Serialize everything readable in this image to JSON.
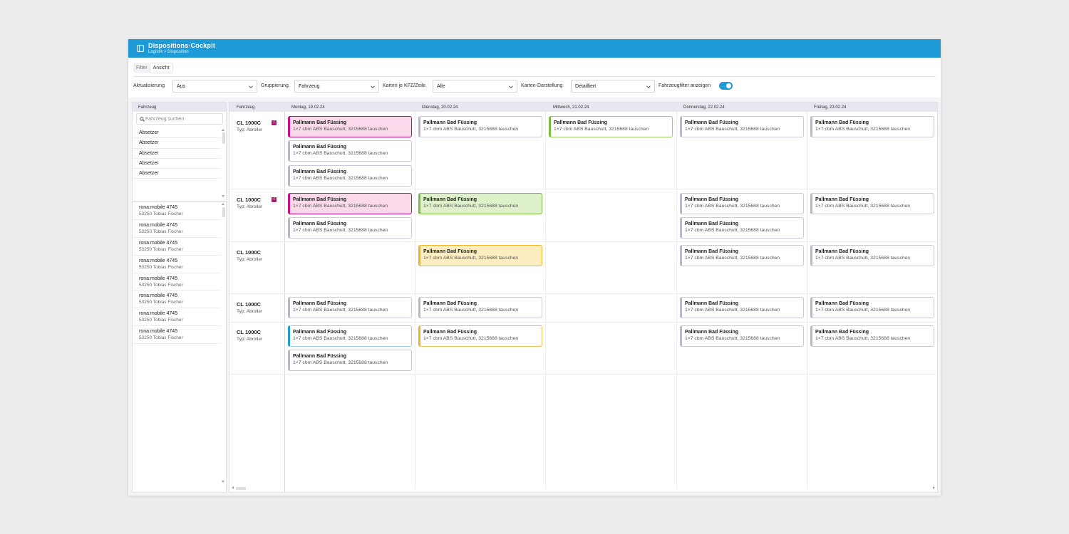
{
  "app": {
    "title": "Dispositions-Cockpit",
    "breadcrumb": "Logistik > Disposition",
    "accent_color": "#1e9ad6"
  },
  "tabs": [
    {
      "label": "Filter",
      "active": false
    },
    {
      "label": "Ansicht",
      "active": true
    }
  ],
  "filters": {
    "refresh": {
      "label": "Aktualisierung",
      "value": "Aus"
    },
    "grouping": {
      "label": "Gruppierung",
      "value": "Fahrzeug"
    },
    "cards_per_row": {
      "label": "Karten je KFZ/Zeile",
      "value": "Alle"
    },
    "card_display": {
      "label": "Karten-Darstellung",
      "value": "Detailliert"
    },
    "vehicle_filter_toggle": {
      "label": "Fahrzeugfilter anzeigen",
      "on": true
    }
  },
  "left_panel": {
    "header": "Fahrzeug",
    "search_placeholder": "Fahrzeug suchen",
    "types": [
      "Absetzer",
      "Absetzer",
      "Absetzer",
      "Absetzer",
      "Absetzer"
    ],
    "vehicles": [
      {
        "name": "rona:mobile 4745",
        "sub": "53250  Tobias Fischer"
      },
      {
        "name": "rona:mobile 4745",
        "sub": "53250  Tobias Fischer"
      },
      {
        "name": "rona:mobile 4745",
        "sub": "53250  Tobias Fischer"
      },
      {
        "name": "rona:mobile 4745",
        "sub": "53250  Tobias Fischer"
      },
      {
        "name": "rona:mobile 4745",
        "sub": "53250  Tobias Fischer"
      },
      {
        "name": "rona:mobile 4745",
        "sub": "53250  Tobias Fischer"
      },
      {
        "name": "rona:mobile 4745",
        "sub": "53250  Tobias Fischer"
      },
      {
        "name": "rona:mobile 4745",
        "sub": "53250  Tobias Fischer"
      }
    ]
  },
  "schedule": {
    "vehicle_header": "Fahrzeug",
    "days": [
      "Montag, 19.02.24",
      "Dienstag, 20.02.24",
      "Mittwoch, 21.02.24",
      "Donnerstag, 22.02.24",
      "Freitag, 23.02.24"
    ],
    "card_title": "Pallmann Bad Füssing",
    "card_subtitle": "1×7 cbm ABS Bauschutt, 3215688 tauschen",
    "badge_text": "!",
    "colors": {
      "pink": "#c4107b",
      "green": "#7cbc3f",
      "yellow": "#f0b429",
      "blue": "#1e9ad6",
      "default": "#b7bacb"
    },
    "rows": [
      {
        "vehicle": "CL 1000C",
        "type": "Typ: Abroller",
        "badge": true,
        "cells": [
          [
            "pink",
            "default",
            "default"
          ],
          [
            "default"
          ],
          [
            "green-outline"
          ],
          [
            "default"
          ],
          [
            "default"
          ]
        ]
      },
      {
        "vehicle": "CL 1000C",
        "type": "Typ: Abroller",
        "badge": true,
        "cells": [
          [
            "pink",
            "default"
          ],
          [
            "green"
          ],
          [],
          [
            "default",
            "default"
          ],
          [
            "default"
          ]
        ]
      },
      {
        "vehicle": "CL 1000C",
        "type": "Typ: Abroller",
        "badge": false,
        "cells": [
          [],
          [
            "yellow"
          ],
          [],
          [
            "default"
          ],
          [
            "default"
          ]
        ]
      },
      {
        "vehicle": "CL 1000C",
        "type": "Typ: Abroller",
        "badge": false,
        "cells": [
          [
            "default"
          ],
          [
            "default"
          ],
          [],
          [
            "default"
          ],
          [
            "default"
          ]
        ]
      },
      {
        "vehicle": "CL 1000C",
        "type": "Typ: Abroller",
        "badge": false,
        "cells": [
          [
            "blue-outline",
            "default"
          ],
          [
            "yellow-outline"
          ],
          [],
          [
            "default"
          ],
          [
            "default"
          ]
        ]
      }
    ]
  }
}
